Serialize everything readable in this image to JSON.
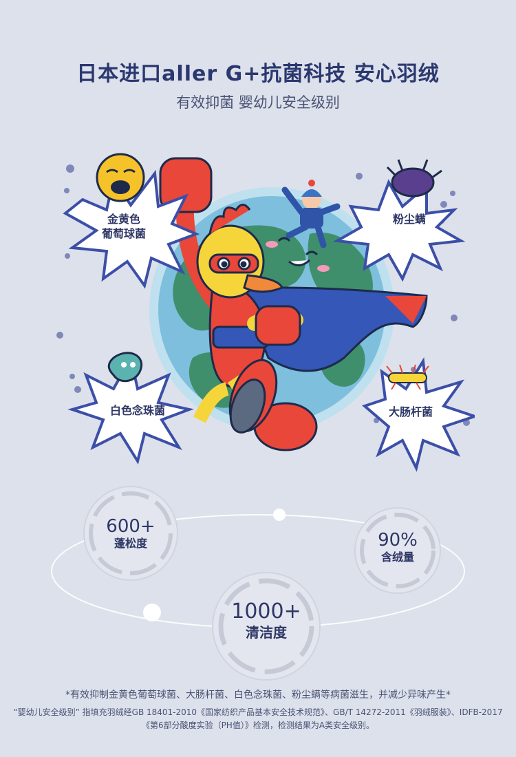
{
  "header": {
    "title": "日本进口aller G+抗菌科技  安心羽绒",
    "subtitle": "有效抑菌 婴幼儿安全级别"
  },
  "bacteria": [
    {
      "label_line1": "金黄色",
      "label_line2": "葡萄球菌"
    },
    {
      "label_line1": "粉尘螨",
      "label_line2": ""
    },
    {
      "label_line1": "白色念珠菌",
      "label_line2": ""
    },
    {
      "label_line1": "大肠杆菌",
      "label_line2": ""
    }
  ],
  "stats": [
    {
      "value": "600+",
      "label": "蓬松度"
    },
    {
      "value": "90%",
      "label": "含绒量"
    },
    {
      "value": "1000+",
      "label": "清洁度"
    }
  ],
  "footnotes": {
    "line1": "*有效抑制金黄色葡萄球菌、大肠杆菌、白色念珠菌、粉尘螨等病菌滋生，并减少异味产生*",
    "line2": "“婴幼儿安全级别” 指填充羽绒经GB 18401-2010《国家纺织产品基本安全技术规范》、GB/T 14272-2011《羽绒服装》、IDFB-2017《第6部分酸度实验（PH值）》检测，检测结果为A类安全级别。"
  },
  "colors": {
    "background": "#dde1eb",
    "title": "#2b3870",
    "burst_blue": "#3c4fa8",
    "cape_blue": "#3457b8",
    "hero_red": "#e8473a",
    "hero_yellow": "#f6d53a"
  }
}
